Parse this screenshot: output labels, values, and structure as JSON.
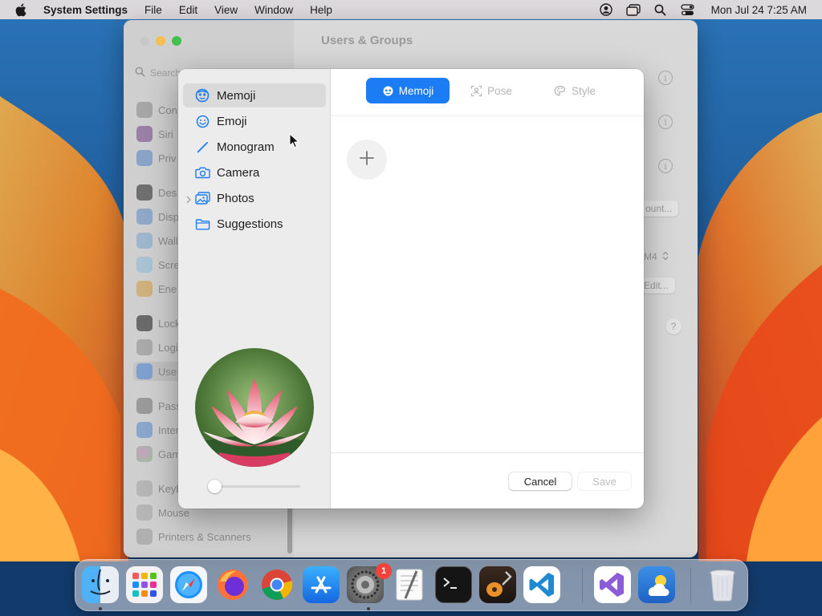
{
  "menubar": {
    "app_name": "System Settings",
    "menus": [
      "File",
      "Edit",
      "View",
      "Window",
      "Help"
    ],
    "clock": "Mon Jul 24  7:25 AM"
  },
  "settings_window": {
    "title": "Users & Groups",
    "search_placeholder": "Search",
    "sidebar": [
      {
        "label": "Con",
        "icon": "control-centre-icon"
      },
      {
        "label": "Siri",
        "icon": "siri-icon"
      },
      {
        "label": "Priv",
        "icon": "privacy-hand-icon"
      },
      {
        "label": "Des",
        "icon": "desktop-dock-icon"
      },
      {
        "label": "Disp",
        "icon": "displays-icon"
      },
      {
        "label": "Wall",
        "icon": "wallpaper-icon"
      },
      {
        "label": "Scre",
        "icon": "screen-saver-icon"
      },
      {
        "label": "Ene",
        "icon": "energy-saver-icon"
      },
      {
        "label": "Lock",
        "icon": "lock-screen-icon"
      },
      {
        "label": "Logi",
        "icon": "login-password-icon"
      },
      {
        "label": "Use",
        "icon": "users-groups-icon",
        "selected": true
      },
      {
        "label": "Pass",
        "icon": "passwords-key-icon"
      },
      {
        "label": "Inter",
        "icon": "internet-accounts-icon"
      },
      {
        "label": "Gam",
        "icon": "game-center-icon"
      },
      {
        "label": "Keyb",
        "icon": "keyboard-icon"
      },
      {
        "label": "Mouse",
        "icon": "mouse-icon"
      },
      {
        "label": "Printers & Scanners",
        "icon": "printer-icon"
      }
    ],
    "pane": {
      "account_button": "ount...",
      "popup_value": "M4",
      "edit_button": "Edit...",
      "help_label": "?"
    }
  },
  "picture_sheet": {
    "sources": [
      {
        "label": "Memoji",
        "icon": "memoji-face-icon",
        "selected": true
      },
      {
        "label": "Emoji",
        "icon": "smiley-icon"
      },
      {
        "label": "Monogram",
        "icon": "pencil-icon"
      },
      {
        "label": "Camera",
        "icon": "camera-icon"
      },
      {
        "label": "Photos",
        "icon": "photos-icon",
        "expandable": true
      },
      {
        "label": "Suggestions",
        "icon": "folder-icon"
      }
    ],
    "tabs": [
      {
        "label": "Memoji",
        "icon": "memoji-face-icon",
        "active": true
      },
      {
        "label": "Pose",
        "icon": "pose-icon",
        "active": false
      },
      {
        "label": "Style",
        "icon": "style-palette-icon",
        "active": false
      }
    ],
    "add_label": "+",
    "zoom_level": 0,
    "cancel_label": "Cancel",
    "save_label": "Save",
    "accent_color": "#1b7cf4"
  },
  "dock": {
    "apps": [
      {
        "name": "Finder",
        "icon": "finder-icon",
        "running": true
      },
      {
        "name": "Launchpad",
        "icon": "launchpad-icon"
      },
      {
        "name": "Safari",
        "icon": "safari-icon"
      },
      {
        "name": "Firefox",
        "icon": "firefox-icon"
      },
      {
        "name": "Chrome",
        "icon": "chrome-icon"
      },
      {
        "name": "App Store",
        "icon": "app-store-icon"
      },
      {
        "name": "System Settings",
        "icon": "system-settings-gear-icon",
        "running": true,
        "badge": "1"
      },
      {
        "name": "TextEdit",
        "icon": "textedit-icon"
      },
      {
        "name": "Terminal",
        "icon": "terminal-icon"
      },
      {
        "name": "GarageBand",
        "icon": "garageband-guitar-icon"
      },
      {
        "name": "Visual Studio Code",
        "icon": "vscode-icon"
      },
      {
        "name": "Visual Studio",
        "icon": "visual-studio-icon"
      },
      {
        "name": "Weather",
        "icon": "weather-icon"
      },
      {
        "name": "Trash",
        "icon": "trash-icon"
      }
    ]
  }
}
